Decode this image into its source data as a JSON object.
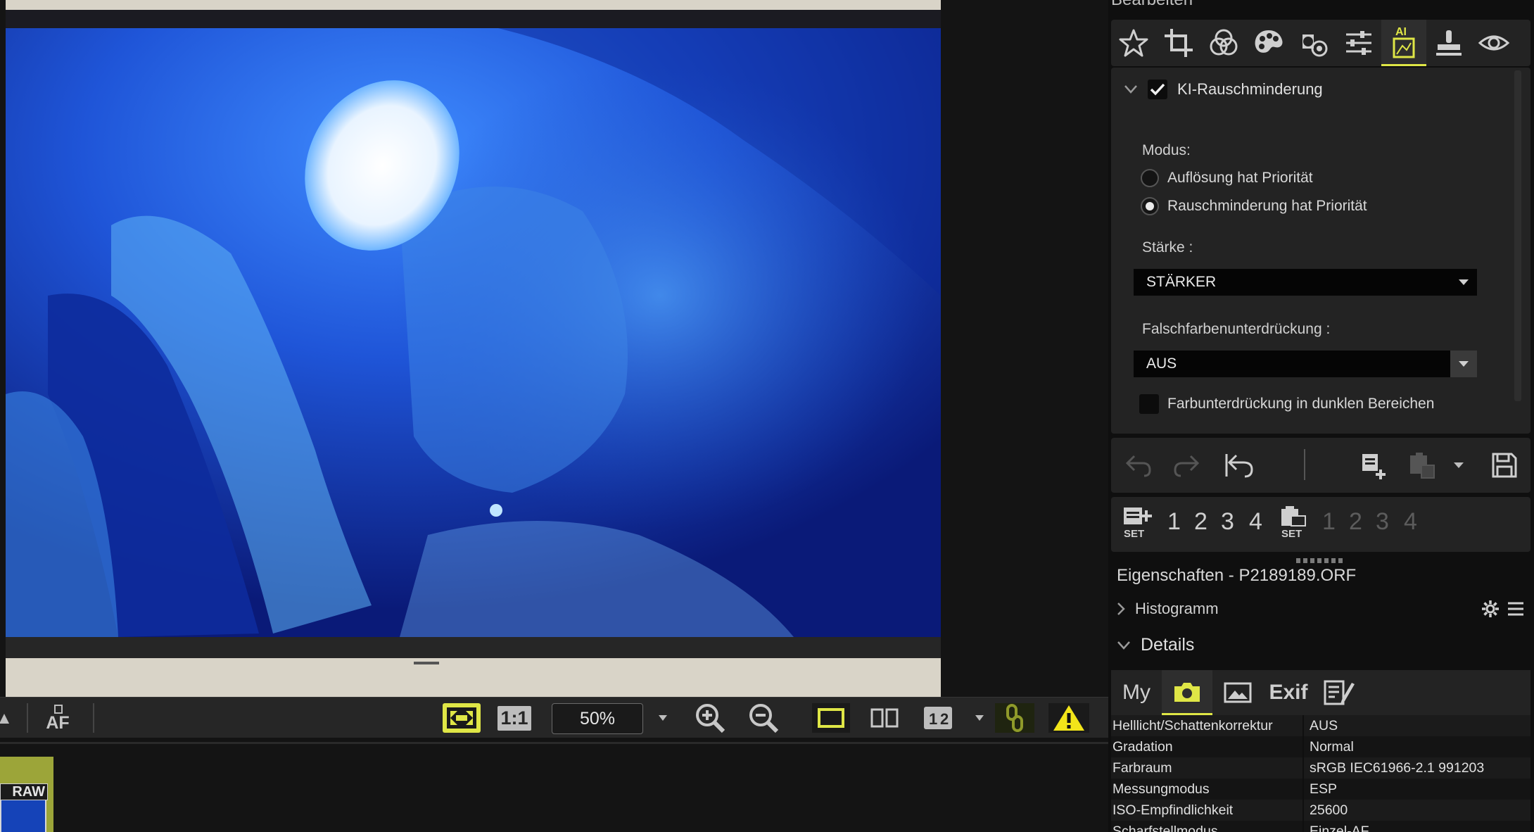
{
  "colors": {
    "accent": "#dfe646",
    "panel": "#232323",
    "background": "#131313",
    "warning": "#f2e51a"
  },
  "panel": {
    "title": "Bearbeiten"
  },
  "edit_tabs": [
    "star-icon",
    "crop-icon",
    "color-circles-icon",
    "palette-icon",
    "tone-icon",
    "sliders-icon",
    "ai-denoise-icon",
    "stamp-icon",
    "eye-icon"
  ],
  "noise_reduction": {
    "title": "KI-Rauschminderung",
    "enabled": true,
    "mode_label": "Modus:",
    "mode_options": [
      "Auflösung hat Priorität",
      "Rauschminderung hat Priorität"
    ],
    "mode_selected": 1,
    "strength_label": "Stärke :",
    "strength_value": "STÄRKER",
    "false_color_label": "Falschfarbenunterdrückung :",
    "false_color_value": "AUS",
    "dark_areas_label": "Farbunterdrückung in dunklen Bereichen",
    "dark_areas_checked": false
  },
  "set_bar": {
    "apply_numbers": [
      "1",
      "2",
      "3",
      "4"
    ],
    "paste_numbers": [
      "1",
      "2",
      "3",
      "4"
    ],
    "set_label": "SET"
  },
  "properties": {
    "title": "Eigenschaften - P2189189.ORF",
    "histogram_label": "Histogramm",
    "details_label": "Details",
    "tabs": [
      "My",
      "camera-icon",
      "image-icon",
      "Exif",
      "edit-notes-icon"
    ],
    "rows": [
      {
        "key": "Helllicht/Schattenkorrektur",
        "value": "AUS"
      },
      {
        "key": "Gradation",
        "value": "Normal"
      },
      {
        "key": "Farbraum",
        "value": "sRGB IEC61966-2.1 991203"
      },
      {
        "key": "Messungmodus",
        "value": "ESP"
      },
      {
        "key": "ISO-Empfindlichkeit",
        "value": "25600"
      },
      {
        "key": "Scharfstellmodus",
        "value": "Einzel-AF"
      }
    ]
  },
  "viewer": {
    "zoom_value": "50%",
    "af_label": "AF",
    "one_to_one_label": "1:1"
  },
  "filmstrip": {
    "badge": "RAW"
  }
}
